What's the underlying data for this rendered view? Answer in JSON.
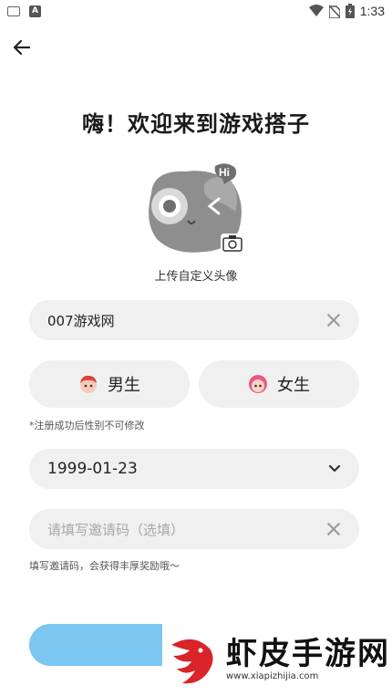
{
  "status_bar": {
    "time": "1:33",
    "keyboard_icon": "keyboard-icon",
    "a_icon": "A"
  },
  "header": {
    "title": "嗨！欢迎来到游戏搭子"
  },
  "avatar": {
    "upload_label": "上传自定义头像",
    "badge_text": "Hi"
  },
  "nickname": {
    "value": "007游戏网"
  },
  "gender": {
    "male_label": "男生",
    "female_label": "女生",
    "note": "*注册成功后性别不可修改"
  },
  "birthday": {
    "value": "1999-01-23"
  },
  "invite": {
    "placeholder": "请填写邀请码（选填）",
    "note": "填写邀请码，会获得丰厚奖励哦～"
  },
  "watermark": {
    "title": "虾皮手游网",
    "url": "www.xiapizhijia.com"
  },
  "colors": {
    "button": "#7cc6f2",
    "field_bg": "#f0f0f0"
  }
}
